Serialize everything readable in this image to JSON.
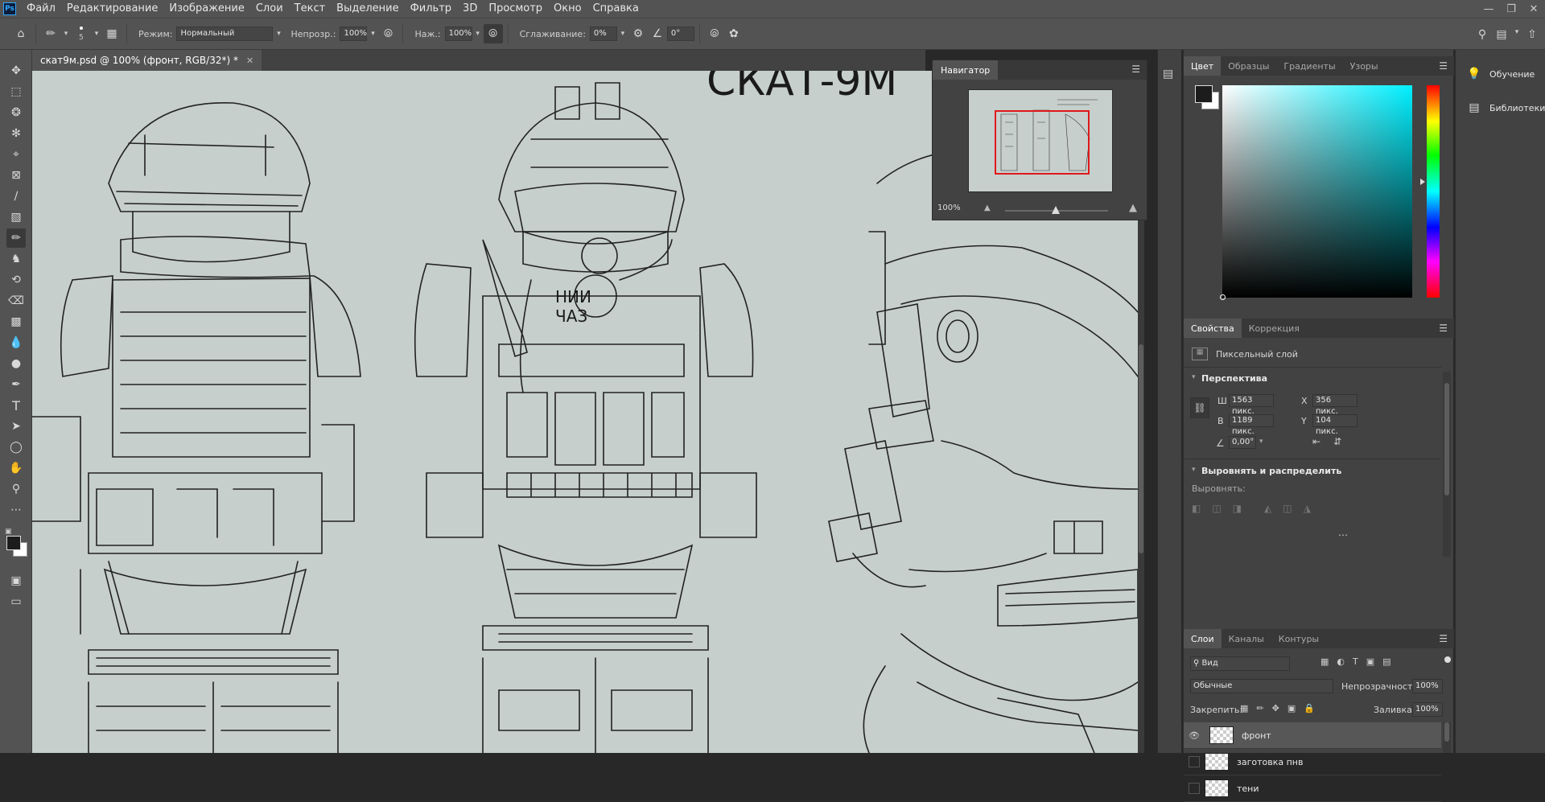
{
  "app": {
    "logo_text": "Ps",
    "menu": [
      "Файл",
      "Редактирование",
      "Изображение",
      "Слои",
      "Текст",
      "Выделение",
      "Фильтр",
      "3D",
      "Просмотр",
      "Окно",
      "Справка"
    ]
  },
  "options": {
    "brush_size": "5",
    "mode_label": "Режим:",
    "mode_value": "Нормальный",
    "opacity_label": "Непрозр.:",
    "opacity_value": "100%",
    "pressure_label": "Наж.:",
    "pressure_value": "100%",
    "smoothing_label": "Сглаживание:",
    "smoothing_value": "0%",
    "angle_value": "0°"
  },
  "document": {
    "tab_title": "скат9м.psd @ 100% (фронт, RGB/32*) *",
    "canvas_text_1": "СКАТ-9М",
    "canvas_text_2": "НИИ",
    "canvas_text_3": "ЧАЗ"
  },
  "navigator": {
    "title": "Навигатор",
    "zoom": "100%"
  },
  "color_panel": {
    "tabs": [
      "Цвет",
      "Образцы",
      "Градиенты",
      "Узоры"
    ],
    "foreground": "#1c1c1c",
    "background": "#ffffff"
  },
  "properties": {
    "tabs": [
      "Свойства",
      "Коррекция"
    ],
    "layer_type": "Пиксельный слой",
    "perspective_title": "Перспектива",
    "w_label": "Ш",
    "w_value": "1563 пикс.",
    "h_label": "В",
    "h_value": "1189 пикс.",
    "x_label": "X",
    "x_value": "356 пикс.",
    "y_label": "Y",
    "y_value": "104 пикс.",
    "angle_value": "0,00°",
    "align_title": "Выровнять и распределить",
    "align_label": "Выровнять:"
  },
  "layers": {
    "tabs": [
      "Слои",
      "Каналы",
      "Контуры"
    ],
    "filter_value": "Вид",
    "blend_mode": "Обычные",
    "opacity_label": "Непрозрачность:",
    "opacity_value": "100%",
    "lock_label": "Закрепить:",
    "fill_label": "Заливка:",
    "fill_value": "100%",
    "items": [
      {
        "name": "фронт",
        "visible": true,
        "selected": true
      },
      {
        "name": "заготовка пнв",
        "visible": false,
        "selected": false
      },
      {
        "name": "тени",
        "visible": false,
        "selected": false
      }
    ]
  },
  "right_panel": {
    "learn": "Обучение",
    "libraries": "Библиотеки"
  }
}
